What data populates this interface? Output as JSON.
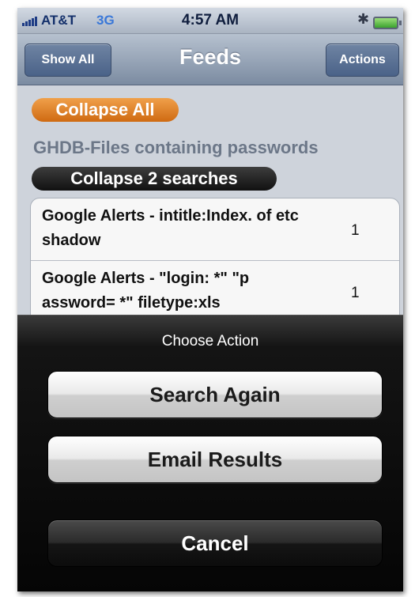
{
  "status_bar": {
    "carrier": "AT&T",
    "network": "3G",
    "time": "4:57 AM",
    "bluetooth_icon": "bluetooth-icon",
    "battery_icon": "battery-icon"
  },
  "nav": {
    "title": "Feeds",
    "left_button": "Show All",
    "right_button": "Actions"
  },
  "content": {
    "collapse_all_label": "Collapse All",
    "feed_title": "GHDB-Files containing passwords",
    "collapse_searches_label": "Collapse 2 searches",
    "results": [
      {
        "title": "Google Alerts - intitle:Index. of etc shadow",
        "count": "1"
      },
      {
        "title": "Google Alerts - \"login: *\" \"p assword= *\" filetype:xls",
        "count": "1"
      }
    ]
  },
  "action_sheet": {
    "title": "Choose Action",
    "buttons": {
      "search_again": "Search Again",
      "email_results": "Email Results",
      "cancel": "Cancel"
    }
  },
  "colors": {
    "collapse_all": "#e07f20",
    "collapse_searches": "#1e1e1e",
    "nav_bar": "#8a99ae"
  }
}
